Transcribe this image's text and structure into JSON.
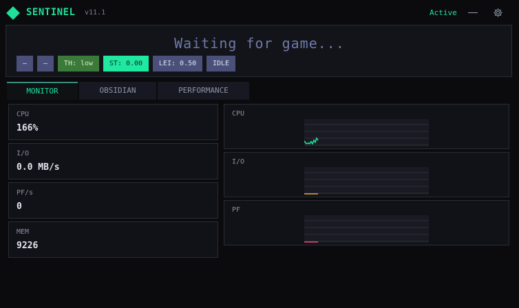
{
  "app": {
    "name": "SENTINEL",
    "version": "v11.1",
    "status": "Active"
  },
  "banner": {
    "title": "Waiting for game...",
    "chips": {
      "dash1": "—",
      "dash2": "—",
      "th": "TH: low",
      "st": "ST: 0.00",
      "lei": "LEI: 0.50",
      "idle": "IDLE"
    }
  },
  "tabs": [
    "MONITOR",
    "OBSIDIAN",
    "PERFORMANCE"
  ],
  "stats": [
    {
      "label": "CPU",
      "value": "166%"
    },
    {
      "label": "I/O",
      "value": "0.0 MB/s"
    },
    {
      "label": "PF/s",
      "value": "0"
    },
    {
      "label": "MEM",
      "value": "9226"
    }
  ],
  "graphs": [
    {
      "label": "CPU",
      "color": "#1ee09a"
    },
    {
      "label": "I/O",
      "color": "#e0a83c"
    },
    {
      "label": "PF",
      "color": "#e0506a"
    }
  ],
  "colors": {
    "accent": "#1ee09a",
    "chip_blue": "#4a5079",
    "chip_green": "#3c7a3a",
    "chip_mint": "#1fe8a0"
  }
}
